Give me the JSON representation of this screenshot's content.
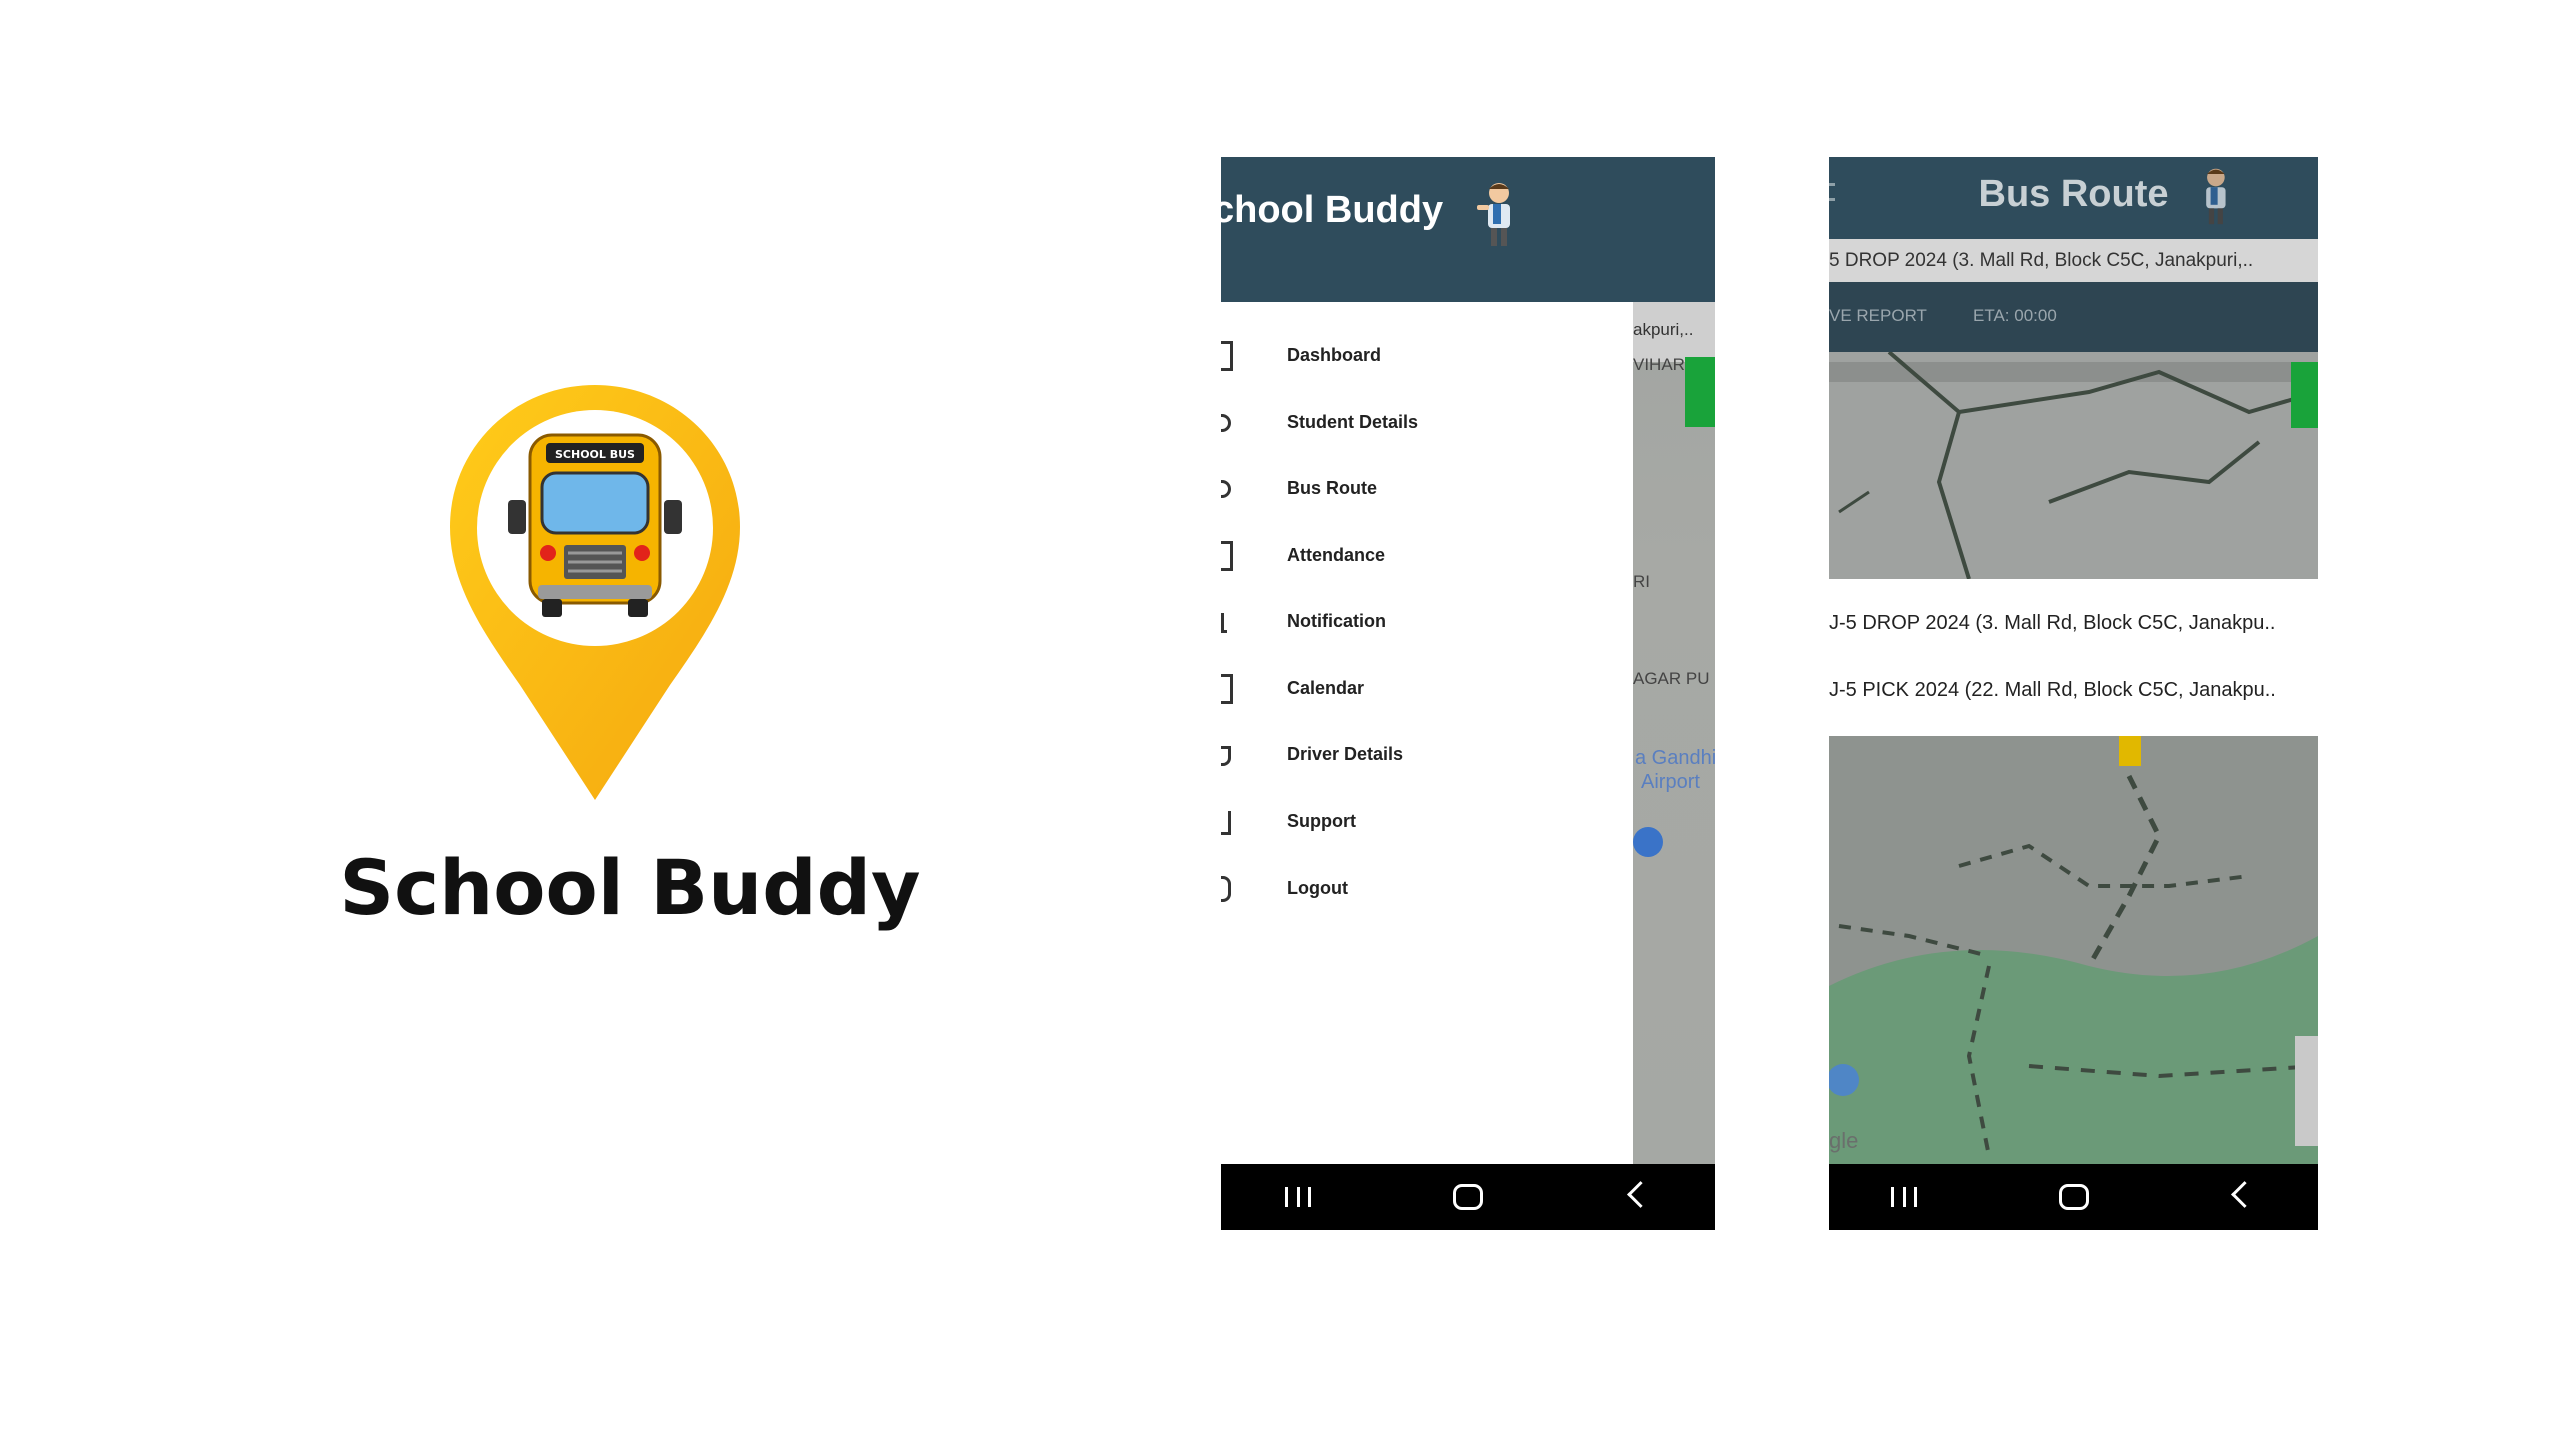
{
  "brand": {
    "title": "School Buddy",
    "logo_text": "SCHOOL BUS"
  },
  "phone1": {
    "drawer_title": "chool Buddy",
    "menu": [
      "Dashboard",
      "Student Details",
      "Bus Route",
      "Attendance",
      "Notification",
      "Calendar",
      "Driver Details",
      "Support",
      "Logout"
    ],
    "map_labels": [
      "akpuri,..",
      "VIHAR",
      "RI",
      "AGAR PU",
      "a Gandhi",
      "Airport"
    ]
  },
  "phone2": {
    "title": "Bus Route",
    "route_bar": "5 DROP 2024 (3. Mall Rd, Block C5C, Janakpuri,..",
    "report_label": "VE REPORT",
    "eta_label": "ETA: 00:00",
    "routes": [
      "J-5 DROP 2024 (3. Mall Rd, Block C5C, Janakpu..",
      "J-5 PICK 2024 (22. Mall Rd, Block C5C, Janakpu.."
    ],
    "map_watermark": "gle"
  },
  "colors": {
    "header": "#2f4c5c",
    "pin_yellow": "#f9b515",
    "bus_yellow": "#f5b400",
    "nav_bar": "#000000"
  }
}
